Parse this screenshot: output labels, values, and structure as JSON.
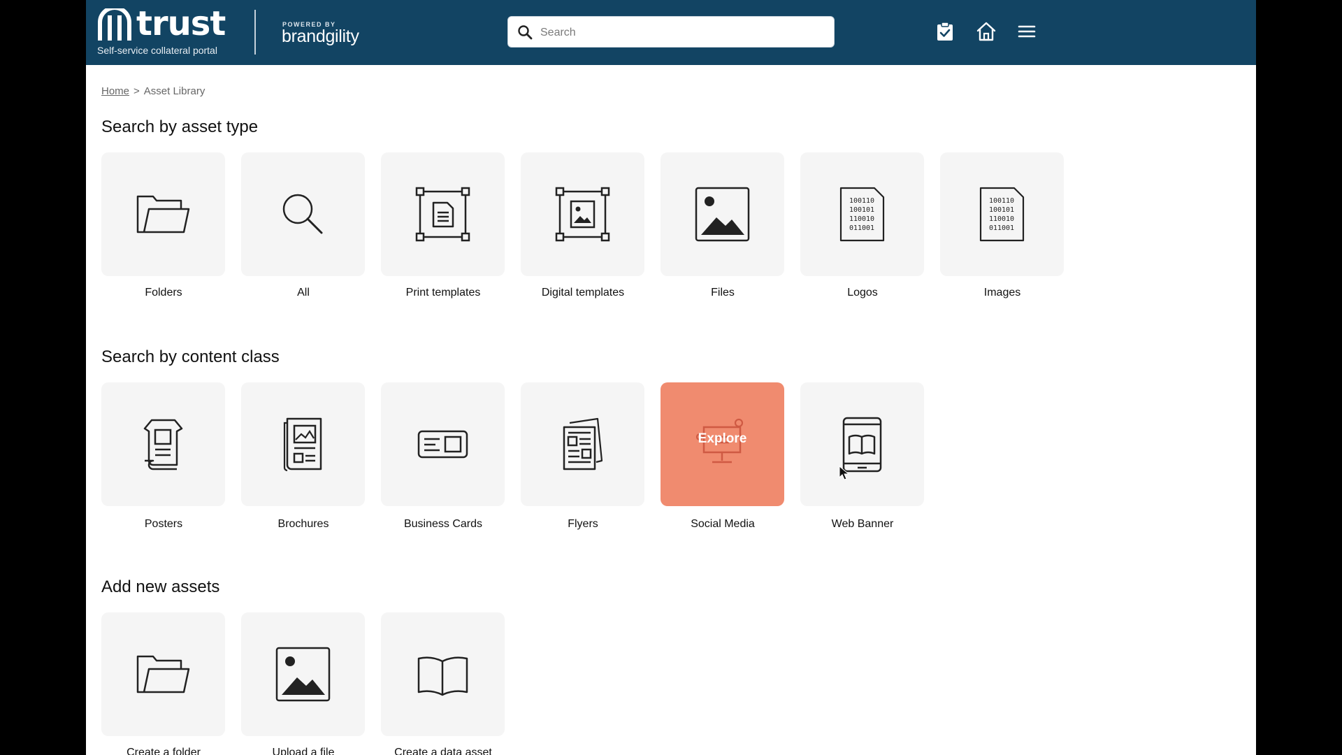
{
  "header": {
    "brand_name": "trust",
    "brand_tagline": "Self-service collateral portal",
    "powered_by": "POWERED BY",
    "powered_name": "brandgility",
    "search": {
      "placeholder": "Search",
      "value": ""
    },
    "icons": [
      "clipboard-check-icon",
      "home-icon",
      "menu-icon"
    ],
    "color": "#124463"
  },
  "breadcrumb": {
    "home": "Home",
    "separator": ">",
    "current": "Asset Library"
  },
  "sections": {
    "asset_type": {
      "title": "Search by asset type",
      "items": [
        {
          "label": "Folders",
          "icon": "folder-icon"
        },
        {
          "label": "All",
          "icon": "search-icon"
        },
        {
          "label": "Print templates",
          "icon": "print-template-icon"
        },
        {
          "label": "Digital templates",
          "icon": "digital-template-icon"
        },
        {
          "label": "Files",
          "icon": "image-icon"
        },
        {
          "label": "Logos",
          "icon": "binary-file-icon"
        },
        {
          "label": "Images",
          "icon": "binary-file-icon"
        }
      ]
    },
    "content_class": {
      "title": "Search by content class",
      "items": [
        {
          "label": "Posters",
          "icon": "poster-icon"
        },
        {
          "label": "Brochures",
          "icon": "brochure-icon"
        },
        {
          "label": "Business Cards",
          "icon": "business-card-icon"
        },
        {
          "label": "Flyers",
          "icon": "flyer-icon"
        },
        {
          "label": "Social Media",
          "icon": "social-media-icon",
          "hover_label": "Explore",
          "active_color": "#f08b6f"
        },
        {
          "label": "Web Banner",
          "icon": "web-banner-icon"
        }
      ]
    },
    "add_new": {
      "title": "Add new assets",
      "items": [
        {
          "label": "Create a folder",
          "icon": "folder-icon"
        },
        {
          "label": "Upload a file",
          "icon": "image-icon"
        },
        {
          "label": "Create a data asset",
          "icon": "book-icon"
        }
      ]
    }
  }
}
